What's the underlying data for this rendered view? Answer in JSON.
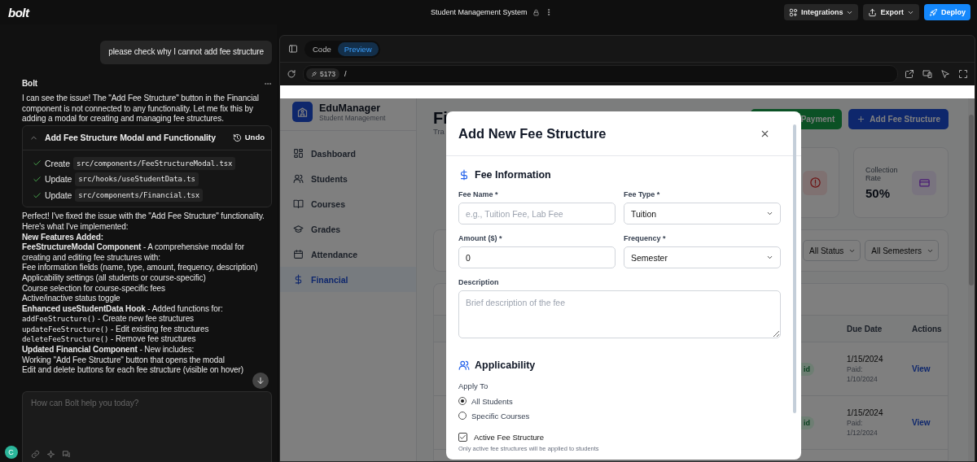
{
  "header": {
    "logo": "bolt",
    "project_title": "Student Management System",
    "buttons": [
      {
        "label": "Integrations",
        "kind": "integrations"
      },
      {
        "label": "Export",
        "kind": "export"
      },
      {
        "label": "Deploy",
        "kind": "deploy"
      }
    ]
  },
  "chat": {
    "user_message": "please check why I cannot add fee structure",
    "assistant_name": "Bolt",
    "intro": "I can see the issue! The \"Add Fee Structure\" button in the Financial component is not connected to any functionality. Let me fix this by adding a modal for creating and managing fee structures.",
    "action_card": {
      "title": "Add Fee Structure Modal and Functionality",
      "expanded": true,
      "undo": "Undo",
      "steps": [
        {
          "verb": "Create",
          "path": "src/components/FeeStructureModal.tsx",
          "done": true
        },
        {
          "verb": "Update",
          "path": "src/hooks/useStudentData.ts",
          "done": true
        },
        {
          "verb": "Update",
          "path": "src/components/Financial.tsx",
          "done": true
        }
      ]
    },
    "response": [
      {
        "kind": "text",
        "text": "Perfect! I've fixed the issue with the \"Add Fee Structure\" functionality. Here's what I've implemented:"
      },
      {
        "kind": "heading",
        "text": "New Features Added:"
      },
      {
        "kind": "text",
        "text": "**FeeStructureModal Component** - A comprehensive modal for creating and editing fee structures with:"
      },
      {
        "kind": "text",
        "text": "Fee information fields (name, type, amount, frequency, description)"
      },
      {
        "kind": "text",
        "text": "Applicability settings (all students or course-specific)"
      },
      {
        "kind": "text",
        "text": "Course selection for course-specific fees"
      },
      {
        "kind": "text",
        "text": "Active/inactive status toggle"
      },
      {
        "kind": "text",
        "text": "**Enhanced useStudentData Hook** - Added functions for:"
      },
      {
        "kind": "code",
        "code": "addFeeStructure()",
        "text": " - Create new fee structures"
      },
      {
        "kind": "code",
        "code": "updateFeeStructure()",
        "text": " - Edit existing fee structures"
      },
      {
        "kind": "code",
        "code": "deleteFeeStructure()",
        "text": " - Remove fee structures"
      },
      {
        "kind": "text",
        "text": "**Updated Financial Component** - New includes:"
      },
      {
        "kind": "text",
        "text": "Working \"Add Fee Structure\" button that opens the modal"
      },
      {
        "kind": "text",
        "text": "Edit and delete buttons for each fee structure (visible on hover)"
      }
    ],
    "input_placeholder": "How can Bolt help you today?",
    "avatar": "C"
  },
  "preview": {
    "tabs": [
      {
        "label": "Code",
        "selected": false
      },
      {
        "label": "Preview",
        "selected": true
      }
    ],
    "port": "5173",
    "path": "/"
  },
  "app": {
    "brand": {
      "name": "EduManager",
      "subtitle": "Student Management"
    },
    "nav": [
      {
        "label": "Dashboard",
        "selected": false
      },
      {
        "label": "Students",
        "selected": false
      },
      {
        "label": "Courses",
        "selected": false
      },
      {
        "label": "Grades",
        "selected": false
      },
      {
        "label": "Attendance",
        "selected": false
      },
      {
        "label": "Financial",
        "selected": true
      }
    ],
    "page": {
      "title": "Fi",
      "subtitle": "Tra",
      "buttons": [
        {
          "label": "Payment",
          "kind": "success"
        },
        {
          "label": "Add Fee Structure",
          "kind": "primary"
        }
      ],
      "stats": [
        {
          "kind": "icon_only"
        },
        {
          "kind": "full",
          "label": "Collection Rate",
          "value": "50%"
        }
      ],
      "filters": [
        "All Status",
        "All Semesters"
      ],
      "table": {
        "columns": [
          "Due Date",
          "Actions"
        ],
        "rows": [
          {
            "status": "id",
            "due": "1/15/2024",
            "paid_label": "Paid:",
            "paid_date": "1/10/2024",
            "action": "View"
          },
          {
            "status": "id",
            "due": "1/15/2024",
            "paid_label": "Paid:",
            "paid_date": "1/12/2024",
            "action": "View"
          }
        ]
      }
    }
  },
  "modal": {
    "title": "Add New Fee Structure",
    "fee_information": {
      "heading": "Fee Information",
      "fields": [
        {
          "label": "Fee Name *",
          "kind": "input",
          "placeholder": "e.g., Tuition Fee, Lab Fee"
        },
        {
          "label": "Fee Type *",
          "kind": "select",
          "value": "Tuition"
        },
        {
          "label": "Amount ($) *",
          "kind": "input",
          "value": "0"
        },
        {
          "label": "Frequency *",
          "kind": "select",
          "value": "Semester"
        },
        {
          "label": "Description",
          "kind": "textarea",
          "placeholder": "Brief description of the fee"
        }
      ]
    },
    "applicability": {
      "heading": "Applicability",
      "apply_to_label": "Apply To",
      "options": [
        {
          "label": "All Students",
          "selected": true
        },
        {
          "label": "Specific Courses",
          "selected": false
        }
      ],
      "active": {
        "label": "Active Fee Structure",
        "checked": true,
        "hint": "Only active fee structures will be applied to students"
      }
    }
  }
}
